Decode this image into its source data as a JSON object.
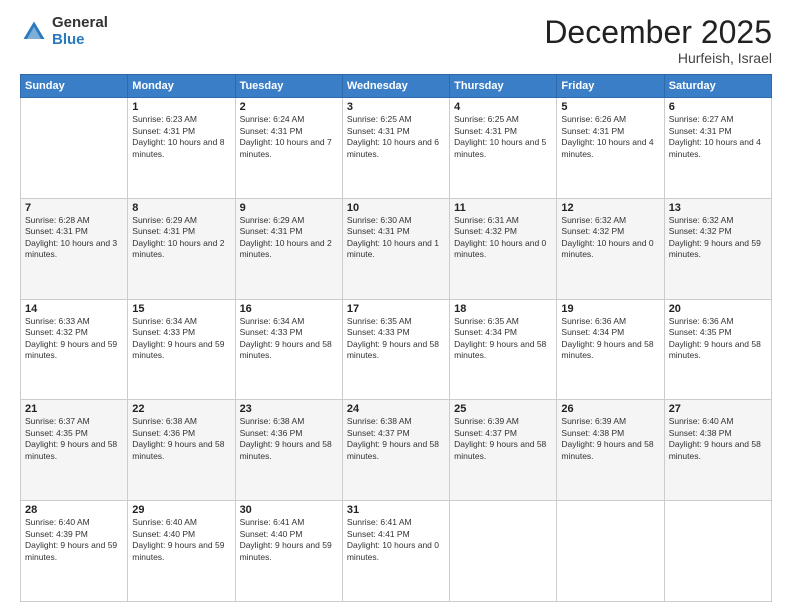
{
  "header": {
    "logo_general": "General",
    "logo_blue": "Blue",
    "month_title": "December 2025",
    "location": "Hurfeish, Israel"
  },
  "days_of_week": [
    "Sunday",
    "Monday",
    "Tuesday",
    "Wednesday",
    "Thursday",
    "Friday",
    "Saturday"
  ],
  "weeks": [
    [
      {
        "day": "",
        "sunrise": "",
        "sunset": "",
        "daylight": ""
      },
      {
        "day": "1",
        "sunrise": "Sunrise: 6:23 AM",
        "sunset": "Sunset: 4:31 PM",
        "daylight": "Daylight: 10 hours and 8 minutes."
      },
      {
        "day": "2",
        "sunrise": "Sunrise: 6:24 AM",
        "sunset": "Sunset: 4:31 PM",
        "daylight": "Daylight: 10 hours and 7 minutes."
      },
      {
        "day": "3",
        "sunrise": "Sunrise: 6:25 AM",
        "sunset": "Sunset: 4:31 PM",
        "daylight": "Daylight: 10 hours and 6 minutes."
      },
      {
        "day": "4",
        "sunrise": "Sunrise: 6:25 AM",
        "sunset": "Sunset: 4:31 PM",
        "daylight": "Daylight: 10 hours and 5 minutes."
      },
      {
        "day": "5",
        "sunrise": "Sunrise: 6:26 AM",
        "sunset": "Sunset: 4:31 PM",
        "daylight": "Daylight: 10 hours and 4 minutes."
      },
      {
        "day": "6",
        "sunrise": "Sunrise: 6:27 AM",
        "sunset": "Sunset: 4:31 PM",
        "daylight": "Daylight: 10 hours and 4 minutes."
      }
    ],
    [
      {
        "day": "7",
        "sunrise": "Sunrise: 6:28 AM",
        "sunset": "Sunset: 4:31 PM",
        "daylight": "Daylight: 10 hours and 3 minutes."
      },
      {
        "day": "8",
        "sunrise": "Sunrise: 6:29 AM",
        "sunset": "Sunset: 4:31 PM",
        "daylight": "Daylight: 10 hours and 2 minutes."
      },
      {
        "day": "9",
        "sunrise": "Sunrise: 6:29 AM",
        "sunset": "Sunset: 4:31 PM",
        "daylight": "Daylight: 10 hours and 2 minutes."
      },
      {
        "day": "10",
        "sunrise": "Sunrise: 6:30 AM",
        "sunset": "Sunset: 4:31 PM",
        "daylight": "Daylight: 10 hours and 1 minute."
      },
      {
        "day": "11",
        "sunrise": "Sunrise: 6:31 AM",
        "sunset": "Sunset: 4:32 PM",
        "daylight": "Daylight: 10 hours and 0 minutes."
      },
      {
        "day": "12",
        "sunrise": "Sunrise: 6:32 AM",
        "sunset": "Sunset: 4:32 PM",
        "daylight": "Daylight: 10 hours and 0 minutes."
      },
      {
        "day": "13",
        "sunrise": "Sunrise: 6:32 AM",
        "sunset": "Sunset: 4:32 PM",
        "daylight": "Daylight: 9 hours and 59 minutes."
      }
    ],
    [
      {
        "day": "14",
        "sunrise": "Sunrise: 6:33 AM",
        "sunset": "Sunset: 4:32 PM",
        "daylight": "Daylight: 9 hours and 59 minutes."
      },
      {
        "day": "15",
        "sunrise": "Sunrise: 6:34 AM",
        "sunset": "Sunset: 4:33 PM",
        "daylight": "Daylight: 9 hours and 59 minutes."
      },
      {
        "day": "16",
        "sunrise": "Sunrise: 6:34 AM",
        "sunset": "Sunset: 4:33 PM",
        "daylight": "Daylight: 9 hours and 58 minutes."
      },
      {
        "day": "17",
        "sunrise": "Sunrise: 6:35 AM",
        "sunset": "Sunset: 4:33 PM",
        "daylight": "Daylight: 9 hours and 58 minutes."
      },
      {
        "day": "18",
        "sunrise": "Sunrise: 6:35 AM",
        "sunset": "Sunset: 4:34 PM",
        "daylight": "Daylight: 9 hours and 58 minutes."
      },
      {
        "day": "19",
        "sunrise": "Sunrise: 6:36 AM",
        "sunset": "Sunset: 4:34 PM",
        "daylight": "Daylight: 9 hours and 58 minutes."
      },
      {
        "day": "20",
        "sunrise": "Sunrise: 6:36 AM",
        "sunset": "Sunset: 4:35 PM",
        "daylight": "Daylight: 9 hours and 58 minutes."
      }
    ],
    [
      {
        "day": "21",
        "sunrise": "Sunrise: 6:37 AM",
        "sunset": "Sunset: 4:35 PM",
        "daylight": "Daylight: 9 hours and 58 minutes."
      },
      {
        "day": "22",
        "sunrise": "Sunrise: 6:38 AM",
        "sunset": "Sunset: 4:36 PM",
        "daylight": "Daylight: 9 hours and 58 minutes."
      },
      {
        "day": "23",
        "sunrise": "Sunrise: 6:38 AM",
        "sunset": "Sunset: 4:36 PM",
        "daylight": "Daylight: 9 hours and 58 minutes."
      },
      {
        "day": "24",
        "sunrise": "Sunrise: 6:38 AM",
        "sunset": "Sunset: 4:37 PM",
        "daylight": "Daylight: 9 hours and 58 minutes."
      },
      {
        "day": "25",
        "sunrise": "Sunrise: 6:39 AM",
        "sunset": "Sunset: 4:37 PM",
        "daylight": "Daylight: 9 hours and 58 minutes."
      },
      {
        "day": "26",
        "sunrise": "Sunrise: 6:39 AM",
        "sunset": "Sunset: 4:38 PM",
        "daylight": "Daylight: 9 hours and 58 minutes."
      },
      {
        "day": "27",
        "sunrise": "Sunrise: 6:40 AM",
        "sunset": "Sunset: 4:38 PM",
        "daylight": "Daylight: 9 hours and 58 minutes."
      }
    ],
    [
      {
        "day": "28",
        "sunrise": "Sunrise: 6:40 AM",
        "sunset": "Sunset: 4:39 PM",
        "daylight": "Daylight: 9 hours and 59 minutes."
      },
      {
        "day": "29",
        "sunrise": "Sunrise: 6:40 AM",
        "sunset": "Sunset: 4:40 PM",
        "daylight": "Daylight: 9 hours and 59 minutes."
      },
      {
        "day": "30",
        "sunrise": "Sunrise: 6:41 AM",
        "sunset": "Sunset: 4:40 PM",
        "daylight": "Daylight: 9 hours and 59 minutes."
      },
      {
        "day": "31",
        "sunrise": "Sunrise: 6:41 AM",
        "sunset": "Sunset: 4:41 PM",
        "daylight": "Daylight: 10 hours and 0 minutes."
      },
      {
        "day": "",
        "sunrise": "",
        "sunset": "",
        "daylight": ""
      },
      {
        "day": "",
        "sunrise": "",
        "sunset": "",
        "daylight": ""
      },
      {
        "day": "",
        "sunrise": "",
        "sunset": "",
        "daylight": ""
      }
    ]
  ]
}
